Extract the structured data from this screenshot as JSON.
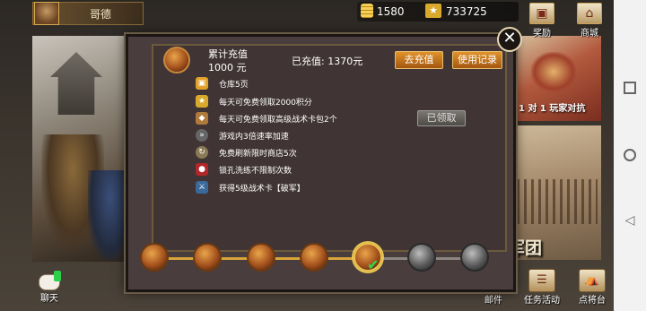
{
  "player": {
    "name": "哥德"
  },
  "resources": {
    "gold": "1580",
    "diamond": "733725"
  },
  "top_buttons": {
    "reward_label": "奖励",
    "mall_label": "商城"
  },
  "background": {
    "pvp_label": "1 对 1 玩家对抗",
    "legion_label": "军团"
  },
  "bottom_bar": {
    "chat_label": "聊天",
    "mail_label": "邮件",
    "tasks_label": "任务活动",
    "generals_label": "点将台"
  },
  "modal": {
    "total_label": "累计充值",
    "total_amount": "1000 元",
    "current_charge": "已充值: 1370元",
    "recharge_button": "去充值",
    "records_button": "使用记录",
    "claimed_button": "已领取",
    "perks": [
      {
        "icon": "gift-icon",
        "text": "仓库5页"
      },
      {
        "icon": "star-icon",
        "text": "每天可免费领取2000积分"
      },
      {
        "icon": "shield-icon",
        "text": "每天可免费领取高级战术卡包2个"
      },
      {
        "icon": "speed-icon",
        "text": "游戏内3倍速率加速"
      },
      {
        "icon": "refresh-icon",
        "text": "免费刷新限时商店5次"
      },
      {
        "icon": "lock-icon",
        "text": "锁孔洗练不限制次数"
      },
      {
        "icon": "sword-card-icon",
        "text": "获得5级战术卡【破军】"
      }
    ],
    "levels": [
      {
        "state": "unlocked"
      },
      {
        "state": "unlocked"
      },
      {
        "state": "unlocked"
      },
      {
        "state": "unlocked"
      },
      {
        "state": "current"
      },
      {
        "state": "locked"
      },
      {
        "state": "locked"
      }
    ]
  }
}
